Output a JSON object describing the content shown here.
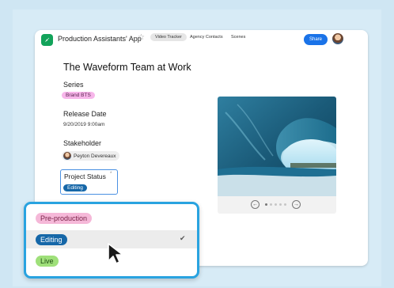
{
  "app": {
    "title": "Production Assistants' App",
    "tabs": [
      {
        "label": "Video Tracker",
        "active": true
      },
      {
        "label": "Agency Contacts",
        "active": false
      },
      {
        "label": "Scenes",
        "active": false
      }
    ],
    "share_label": "Share",
    "star_icon": "star-icon",
    "accent_color": "#1a73e8"
  },
  "record": {
    "title": "The Waveform Team at Work",
    "series": {
      "label": "Series",
      "value": "Brand BTS"
    },
    "release_date": {
      "label": "Release Date",
      "value": "9/20/2019  9:00am"
    },
    "stakeholder": {
      "label": "Stakeholder",
      "value": "Peyton Devereaux"
    },
    "project_status": {
      "label": "Project Status",
      "required_marker": "*",
      "value": "Editing"
    }
  },
  "image": {
    "subject": "ocean-wave-barrel",
    "carousel": {
      "current": 1,
      "total": 5
    }
  },
  "dropdown": {
    "options": [
      {
        "label": "Pre-production",
        "bg": "#f5b8d8",
        "fg": "#7a2248",
        "selected": false
      },
      {
        "label": "Editing",
        "bg": "#1667a8",
        "fg": "#ffffff",
        "selected": true
      },
      {
        "label": "Live",
        "bg": "#9fe07a",
        "fg": "#1e4d12",
        "selected": false
      }
    ],
    "border_color": "#29a3e0"
  }
}
